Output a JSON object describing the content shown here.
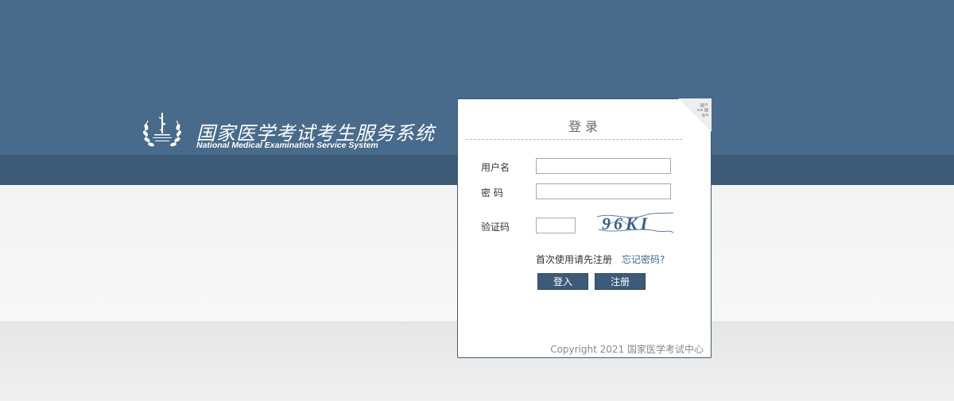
{
  "brand": {
    "title_cn": "国家医学考试考生服务系统",
    "title_en": "National Medical Examination Service System",
    "emblem_icon": "medical-laurel-emblem-icon"
  },
  "login": {
    "title": "登录",
    "qr_icon": "qr-code-icon",
    "username_label": "用户名",
    "username_value": "",
    "password_label": "密 码",
    "password_value": "",
    "captcha_label": "验证码",
    "captcha_value": "",
    "captcha_text": "96KI",
    "hint": "首次使用请先注册",
    "forgot_link": "忘记密码?",
    "login_button": "登入",
    "register_button": "注册",
    "copyright": "Copyright 2021 国家医学考试中心"
  },
  "colors": {
    "header_blue": "#486b8b",
    "header_dark": "#3c5a76",
    "button": "#3d5b79",
    "link": "#3a6896"
  }
}
